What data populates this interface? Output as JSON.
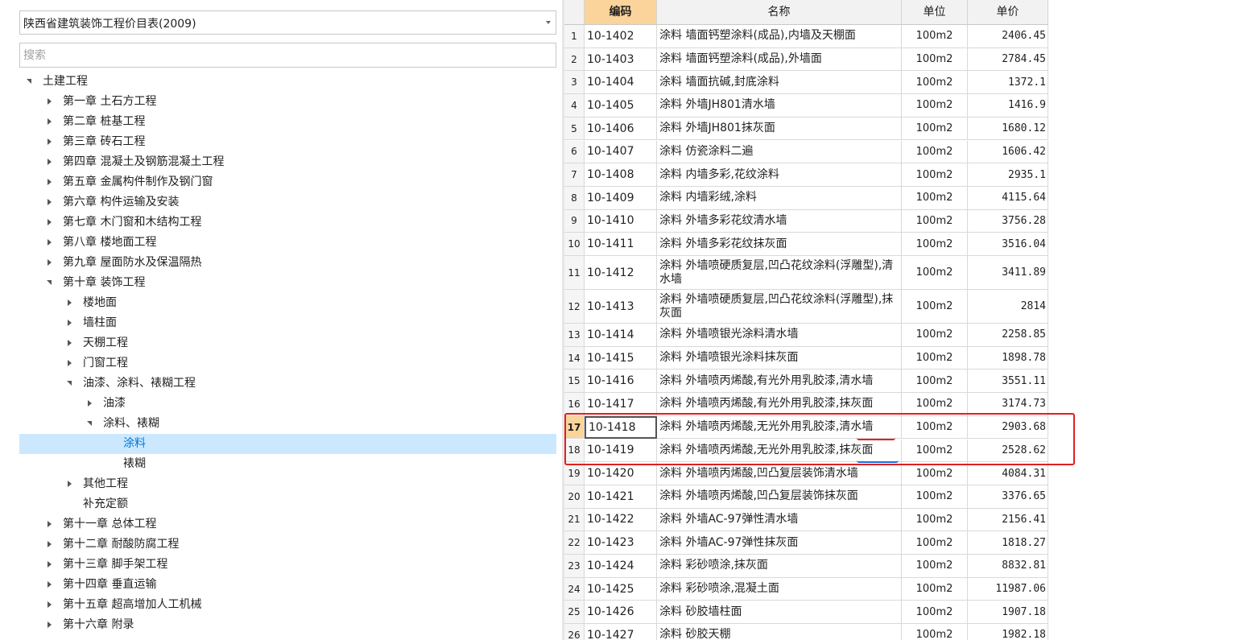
{
  "left_panel": {
    "library_select": {
      "value": "陕西省建筑装饰工程价目表(2009)"
    },
    "search": {
      "placeholder": "搜索"
    },
    "tree": [
      {
        "label": "土建工程",
        "level": 0,
        "state": "open"
      },
      {
        "label": "第一章 土石方工程",
        "level": 1,
        "state": "closed"
      },
      {
        "label": "第二章 桩基工程",
        "level": 1,
        "state": "closed"
      },
      {
        "label": "第三章 砖石工程",
        "level": 1,
        "state": "closed"
      },
      {
        "label": "第四章 混凝土及钢筋混凝土工程",
        "level": 1,
        "state": "closed"
      },
      {
        "label": "第五章 金属构件制作及钢门窗",
        "level": 1,
        "state": "closed"
      },
      {
        "label": "第六章 构件运输及安装",
        "level": 1,
        "state": "closed"
      },
      {
        "label": "第七章 木门窗和木结构工程",
        "level": 1,
        "state": "closed"
      },
      {
        "label": "第八章 楼地面工程",
        "level": 1,
        "state": "closed"
      },
      {
        "label": "第九章 屋面防水及保温隔热",
        "level": 1,
        "state": "closed"
      },
      {
        "label": "第十章 装饰工程",
        "level": 1,
        "state": "open"
      },
      {
        "label": "楼地面",
        "level": 2,
        "state": "closed"
      },
      {
        "label": "墙柱面",
        "level": 2,
        "state": "closed"
      },
      {
        "label": "天棚工程",
        "level": 2,
        "state": "closed"
      },
      {
        "label": "门窗工程",
        "level": 2,
        "state": "closed"
      },
      {
        "label": "油漆、涂料、裱糊工程",
        "level": 2,
        "state": "open"
      },
      {
        "label": "油漆",
        "level": 3,
        "state": "closed"
      },
      {
        "label": "涂料、裱糊",
        "level": 3,
        "state": "open"
      },
      {
        "label": "涂料",
        "level": 4,
        "state": "leaf",
        "selected": true
      },
      {
        "label": "裱糊",
        "level": 4,
        "state": "leaf"
      },
      {
        "label": "其他工程",
        "level": 2,
        "state": "closed"
      },
      {
        "label": "补充定额",
        "level": 2,
        "state": "leaf"
      },
      {
        "label": "第十一章 总体工程",
        "level": 1,
        "state": "closed"
      },
      {
        "label": "第十二章 耐酸防腐工程",
        "level": 1,
        "state": "closed"
      },
      {
        "label": "第十三章 脚手架工程",
        "level": 1,
        "state": "closed"
      },
      {
        "label": "第十四章 垂直运输",
        "level": 1,
        "state": "closed"
      },
      {
        "label": "第十五章 超高增加人工机械",
        "level": 1,
        "state": "closed"
      },
      {
        "label": "第十六章 附录",
        "level": 1,
        "state": "closed"
      }
    ]
  },
  "grid": {
    "columns": {
      "index": "",
      "code": "编码",
      "name": "名称",
      "unit": "单位",
      "price": "单价"
    },
    "current_row": 17,
    "rows": [
      {
        "no": "1",
        "code": "10-1402",
        "name": "涂料 墙面钙塑涂料(成品),内墙及天棚面",
        "unit": "100m2",
        "price": "2406.45"
      },
      {
        "no": "2",
        "code": "10-1403",
        "name": "涂料 墙面钙塑涂料(成品),外墙面",
        "unit": "100m2",
        "price": "2784.45"
      },
      {
        "no": "3",
        "code": "10-1404",
        "name": "涂料 墙面抗碱,封底涂料",
        "unit": "100m2",
        "price": "1372.1"
      },
      {
        "no": "4",
        "code": "10-1405",
        "name": "涂料 外墙JH801清水墙",
        "unit": "100m2",
        "price": "1416.9"
      },
      {
        "no": "5",
        "code": "10-1406",
        "name": "涂料 外墙JH801抹灰面",
        "unit": "100m2",
        "price": "1680.12"
      },
      {
        "no": "6",
        "code": "10-1407",
        "name": "涂料 仿瓷涂料二遍",
        "unit": "100m2",
        "price": "1606.42"
      },
      {
        "no": "7",
        "code": "10-1408",
        "name": "涂料 内墙多彩,花纹涂料",
        "unit": "100m2",
        "price": "2935.1"
      },
      {
        "no": "8",
        "code": "10-1409",
        "name": "涂料 内墙彩绒,涂料",
        "unit": "100m2",
        "price": "4115.64"
      },
      {
        "no": "9",
        "code": "10-1410",
        "name": "涂料 外墙多彩花纹清水墙",
        "unit": "100m2",
        "price": "3756.28"
      },
      {
        "no": "10",
        "code": "10-1411",
        "name": "涂料 外墙多彩花纹抹灰面",
        "unit": "100m2",
        "price": "3516.04"
      },
      {
        "no": "11",
        "code": "10-1412",
        "name": "涂料 外墙喷硬质复层,凹凸花纹涂料(浮雕型),清水墙",
        "unit": "100m2",
        "price": "3411.89"
      },
      {
        "no": "12",
        "code": "10-1413",
        "name": "涂料 外墙喷硬质复层,凹凸花纹涂料(浮雕型),抹灰面",
        "unit": "100m2",
        "price": "2814"
      },
      {
        "no": "13",
        "code": "10-1414",
        "name": "涂料 外墙喷银光涂料清水墙",
        "unit": "100m2",
        "price": "2258.85"
      },
      {
        "no": "14",
        "code": "10-1415",
        "name": "涂料 外墙喷银光涂料抹灰面",
        "unit": "100m2",
        "price": "1898.78"
      },
      {
        "no": "15",
        "code": "10-1416",
        "name": "涂料 外墙喷丙烯酸,有光外用乳胶漆,清水墙",
        "unit": "100m2",
        "price": "3551.11"
      },
      {
        "no": "16",
        "code": "10-1417",
        "name": "涂料 外墙喷丙烯酸,有光外用乳胶漆,抹灰面",
        "unit": "100m2",
        "price": "3174.73"
      },
      {
        "no": "17",
        "code": "10-1418",
        "name": "涂料 外墙喷丙烯酸,无光外用乳胶漆,清水墙",
        "unit": "100m2",
        "price": "2903.68"
      },
      {
        "no": "18",
        "code": "10-1419",
        "name": "涂料 外墙喷丙烯酸,无光外用乳胶漆,抹灰面",
        "unit": "100m2",
        "price": "2528.62"
      },
      {
        "no": "19",
        "code": "10-1420",
        "name": "涂料 外墙喷丙烯酸,凹凸复层装饰清水墙",
        "unit": "100m2",
        "price": "4084.31"
      },
      {
        "no": "20",
        "code": "10-1421",
        "name": "涂料 外墙喷丙烯酸,凹凸复层装饰抹灰面",
        "unit": "100m2",
        "price": "3376.65"
      },
      {
        "no": "21",
        "code": "10-1422",
        "name": "涂料 外墙AC-97弹性清水墙",
        "unit": "100m2",
        "price": "2156.41"
      },
      {
        "no": "22",
        "code": "10-1423",
        "name": "涂料 外墙AC-97弹性抹灰面",
        "unit": "100m2",
        "price": "1818.27"
      },
      {
        "no": "23",
        "code": "10-1424",
        "name": "涂料 彩砂喷涂,抹灰面",
        "unit": "100m2",
        "price": "8832.81"
      },
      {
        "no": "24",
        "code": "10-1425",
        "name": "涂料 彩砂喷涂,混凝土面",
        "unit": "100m2",
        "price": "11987.06"
      },
      {
        "no": "25",
        "code": "10-1426",
        "name": "涂料 砂胶墙柱面",
        "unit": "100m2",
        "price": "1907.18"
      },
      {
        "no": "26",
        "code": "10-1427",
        "name": "涂料 砂胶天棚",
        "unit": "100m2",
        "price": "1982.18"
      }
    ]
  },
  "annotations": {
    "box_color": "#e02020",
    "underline_row17_color": "#e02020",
    "underline_row18_color": "#1e6fd9"
  },
  "colors": {
    "selected_bg": "#cce8ff",
    "selected_text": "#0078d7",
    "active_header_bg": "#fbd49b"
  }
}
